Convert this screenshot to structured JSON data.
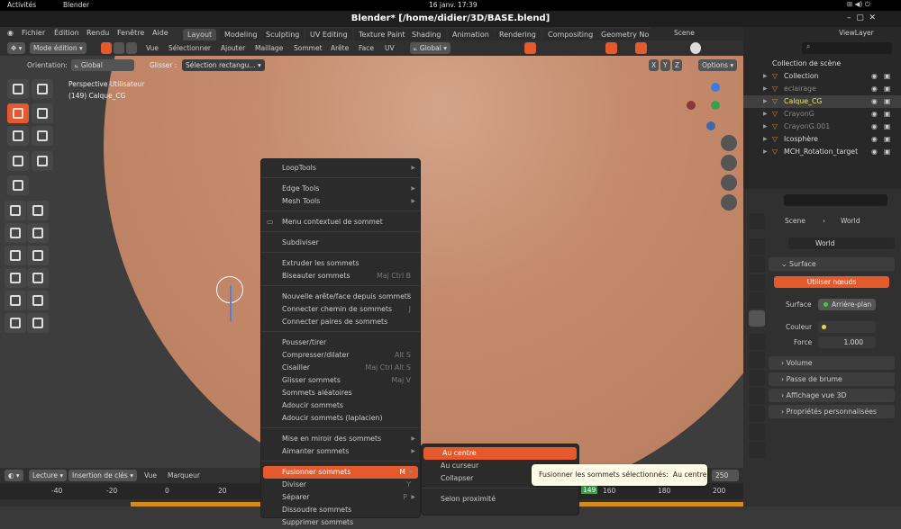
{
  "system": {
    "activities": "Activités",
    "app": "Blender",
    "clock": "16 janv.  17:39"
  },
  "window_title": "Blender* [/home/didier/3D/BASE.blend]",
  "menus": [
    "Fichier",
    "Édition",
    "Rendu",
    "Fenêtre",
    "Aide"
  ],
  "workspaces": [
    {
      "label": "Layout",
      "active": true
    },
    {
      "label": "Modeling"
    },
    {
      "label": "Sculpting"
    },
    {
      "label": "UV Editing"
    },
    {
      "label": "Texture Paint"
    },
    {
      "label": "Shading"
    },
    {
      "label": "Animation"
    },
    {
      "label": "Rendering"
    },
    {
      "label": "Compositing"
    },
    {
      "label": "Geometry No"
    }
  ],
  "scene": "Scene",
  "viewlayer": "ViewLayer",
  "header": {
    "mode": "Mode édition",
    "items": [
      "Vue",
      "Sélectionner",
      "Ajouter",
      "Maillage",
      "Sommet",
      "Arête",
      "Face",
      "UV"
    ],
    "transform": "Global"
  },
  "toolsettings": {
    "orientation_label": "Orientation:",
    "orientation": "Global",
    "drag_label": "Glisser :",
    "drag": "Sélection rectangu...",
    "axes": [
      "X",
      "Y",
      "Z"
    ],
    "options": "Options"
  },
  "viewport": {
    "view_name": "Perspective Utilisateur",
    "object": "(149) Calque_CG"
  },
  "context_menu": [
    {
      "label": "LoopTools",
      "sub": true
    },
    {
      "sep": true
    },
    {
      "label": "Edge Tools",
      "sub": true
    },
    {
      "label": "Mesh Tools",
      "sub": true
    },
    {
      "sep": true
    },
    {
      "label": "Menu contextuel de sommet",
      "icon": true
    },
    {
      "sep": true
    },
    {
      "label": "Subdiviser"
    },
    {
      "sep": true
    },
    {
      "label": "Extruder les sommets"
    },
    {
      "label": "Biseauter sommets",
      "shortcut": "Maj Ctrl B"
    },
    {
      "sep": true
    },
    {
      "label": "Nouvelle arête/face depuis sommets",
      "shortcut": "F"
    },
    {
      "label": "Connecter chemin de sommets",
      "shortcut": "J"
    },
    {
      "label": "Connecter paires de sommets"
    },
    {
      "sep": true
    },
    {
      "label": "Pousser/tirer"
    },
    {
      "label": "Compresser/dilater",
      "shortcut": "Alt S"
    },
    {
      "label": "Cisailler",
      "shortcut": "Maj Ctrl Alt S"
    },
    {
      "label": "Glisser sommets",
      "shortcut": "Maj V"
    },
    {
      "label": "Sommets aléatoires"
    },
    {
      "label": "Adoucir sommets"
    },
    {
      "label": "Adoucir sommets (laplacien)"
    },
    {
      "sep": true
    },
    {
      "label": "Mise en miroir des sommets",
      "sub": true
    },
    {
      "label": "Aimanter sommets",
      "sub": true
    },
    {
      "sep": true
    },
    {
      "label": "Fusionner sommets",
      "shortcut": "M",
      "sub": true,
      "highlight": true
    },
    {
      "label": "Diviser",
      "shortcut": "Y"
    },
    {
      "label": "Séparer",
      "shortcut": "P",
      "sub": true
    },
    {
      "label": "Dissoudre sommets"
    },
    {
      "label": "Supprimer sommets"
    }
  ],
  "submenu": [
    {
      "label": "Au centre",
      "highlight": true
    },
    {
      "label": "Au curseur"
    },
    {
      "label": "Collapser"
    },
    {
      "sep": true
    },
    {
      "label": "Selon proximité"
    }
  ],
  "tooltip": {
    "text": "Fusionner les sommets sélectionnés:",
    "value": "Au centre"
  },
  "timeline": {
    "playback": "Lecture",
    "keying": "Insertion de clés",
    "view": "Vue",
    "marker": "Marqueur",
    "end_frame": "250",
    "current_frame": "149",
    "ticks": [
      "-40",
      "-20",
      "0",
      "20",
      "160",
      "180",
      "200"
    ]
  },
  "outliner": {
    "root": "Collection de scène",
    "items": [
      {
        "label": "Collection",
        "color": "#dddddd"
      },
      {
        "label": "eclairage",
        "color": "#888888"
      },
      {
        "label": "Calque_CG",
        "color": "#e8e86a",
        "selected": true
      },
      {
        "label": "CrayonG",
        "color": "#888888"
      },
      {
        "label": "CrayonG.001",
        "color": "#888888"
      },
      {
        "label": "Icosphère",
        "color": "#dddddd"
      },
      {
        "label": "MCH_Rotation_target",
        "color": "#dddddd"
      }
    ]
  },
  "properties": {
    "breadcrumb": [
      "Scene",
      "World"
    ],
    "world_name": "World",
    "surface_panel": "Surface",
    "use_nodes": "Utiliser nœuds",
    "surface_label": "Surface",
    "surface_value": "Arrière-plan",
    "color_label": "Couleur",
    "strength_label": "Force",
    "strength_value": "1.000",
    "panels": [
      "Volume",
      "Passe de brume",
      "Affichage vue 3D",
      "Propriétés personnalisées"
    ]
  },
  "colors": {
    "accent": "#e45a2c",
    "sphere": "#c58a6c"
  }
}
